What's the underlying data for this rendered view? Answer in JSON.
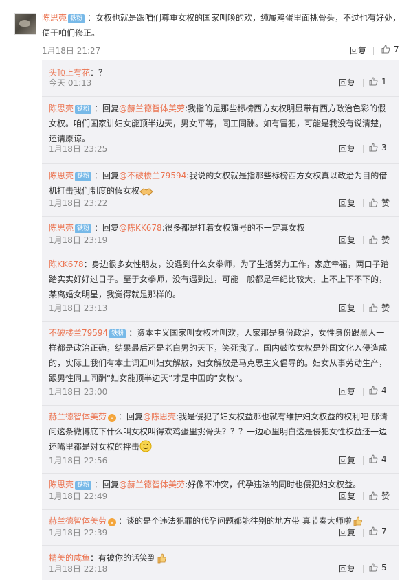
{
  "main_comment": {
    "author": "陈思壳",
    "badge": "铁粉",
    "text": "：女权也就是跟咱们尊重女权的国家叫唤的欢，纯属鸡蛋里面挑骨头，不过也有好处，便于咱们修正。",
    "time": "1月18日 21:27",
    "reply_label": "回复",
    "likes": "7"
  },
  "replies": [
    {
      "author": "头顶上有花",
      "badge": "",
      "vbadge": false,
      "reply_to": "",
      "text": "：？",
      "time": "今天 01:13",
      "reply_label": "回复",
      "likes": "1"
    },
    {
      "author": "陈思壳",
      "badge": "铁粉",
      "vbadge": false,
      "reply_prefix": "：回复",
      "reply_to": "@赫兰德智体美劳",
      "text": ":我指的是那些标榜西方女权明显带有西方政治色彩的假女权。咱们国家讲妇女能顶半边天，男女平等，同工同酬。如有冒犯，可能是我没有说清楚，还请原谅。",
      "time": "1月18日 23:25",
      "reply_label": "回复",
      "likes": "3"
    },
    {
      "author": "陈思壳",
      "badge": "铁粉",
      "vbadge": false,
      "reply_prefix": "：回复",
      "reply_to": "@不破楼兰79594",
      "text": ":我说的女权就是指那些标榜西方女权真以政治为目的借机打击我们制度的假女权",
      "time": "1月18日 23:22",
      "reply_label": "回复",
      "likes": "赞",
      "emoji": "handshake"
    },
    {
      "author": "陈思壳",
      "badge": "铁粉",
      "vbadge": false,
      "reply_prefix": "：回复",
      "reply_to": "@陈KK678",
      "text": ":很多都是打着女权旗号的不一定真女权",
      "time": "1月18日 23:19",
      "reply_label": "回复",
      "likes": "赞"
    },
    {
      "author": "陈KK678",
      "badge": "",
      "vbadge": false,
      "reply_to": "",
      "text": "：身边很多女性朋友，没遇到什么女拳师，为了生活努力工作，家庭幸福，两口子踏踏实实好好过日子。至于女拳师，没有遇到过，可能一般都是年纪比较大，上不上下不下的，某离婚女明星，我觉得就是那样的。",
      "time": "1月18日 23:13",
      "reply_label": "回复",
      "likes": "赞"
    },
    {
      "author": "不破楼兰79594",
      "badge": "铁粉",
      "vbadge": false,
      "reply_to": "",
      "text": "：资本主义国家叫女权才叫欢，人家那是身份政治，女性身份跟黑人一样都是政治正确，结果最后还是老白男的天下，笑死我了。国内鼓吹女权是外国文化入侵造成的，实际上我们有本土词汇叫妇女解放，妇女解放是马克思主义倡导的。妇女从事劳动生产，跟男性同工同酬“妇女能顶半边天”才是中国的“女权”。",
      "time": "1月18日 23:00",
      "reply_label": "回复",
      "likes": "4"
    },
    {
      "author": "赫兰德智体美劳",
      "badge": "",
      "vbadge": true,
      "reply_prefix": "：回复",
      "reply_to": "@陈思壳",
      "text": ":我是侵犯了妇女权益那也就有维护妇女权益的权利吧 那请问这条微博底下什么叫女权叫得欢鸡蛋里挑骨头？？？一边心里明白这是侵犯女性权益还一边还嘴里都是对女权的抨击",
      "time": "1月18日 22:56",
      "reply_label": "回复",
      "likes": "4",
      "emoji": "smile"
    },
    {
      "author": "陈思壳",
      "badge": "铁粉",
      "vbadge": false,
      "reply_prefix": "：回复",
      "reply_to": "@赫兰德智体美劳",
      "text": ":好像不冲突，代孕违法的同时也侵犯妇女权益。",
      "time": "1月18日 22:49",
      "reply_label": "回复",
      "likes": "赞"
    },
    {
      "author": "赫兰德智体美劳",
      "badge": "",
      "vbadge": true,
      "reply_to": "",
      "text": "：谈的是个违法犯罪的代孕问题都能往别的地方带 真节奏大师啦",
      "time": "1月18日 22:39",
      "reply_label": "回复",
      "likes": "7",
      "emoji": "thumb"
    },
    {
      "author": "精美的咸鱼",
      "badge": "",
      "vbadge": false,
      "reply_to": "",
      "text": "：有被你的话笑到",
      "time": "1月18日 22:18",
      "reply_label": "回复",
      "likes": "5",
      "emoji": "thumb"
    }
  ],
  "icons": {
    "like": "thumbs-up-icon",
    "vip": "vip-badge-icon"
  },
  "colors": {
    "name": "#eb7350",
    "badge": "#77b9e8",
    "reply_bg": "#f2f2f5",
    "vip": "#f4a53b"
  }
}
